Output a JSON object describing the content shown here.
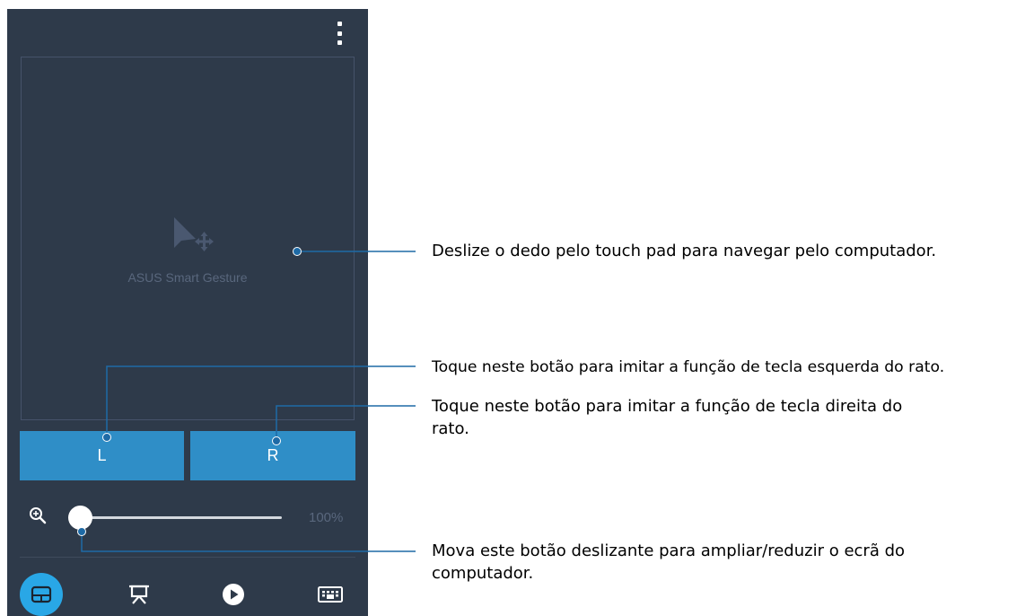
{
  "touchpad": {
    "label": "ASUS Smart Gesture"
  },
  "buttons": {
    "left_label": "L",
    "right_label": "R"
  },
  "zoom": {
    "value_text": "100%",
    "slider_level_percent": 0
  },
  "nav": {
    "items": [
      {
        "icon": "touchpad-icon",
        "active": true
      },
      {
        "icon": "presentation-icon",
        "active": false
      },
      {
        "icon": "play-icon",
        "active": false
      },
      {
        "icon": "keyboard-icon",
        "active": false
      }
    ]
  },
  "callouts": {
    "touchpad": "Deslize o dedo pelo touch pad para navegar pelo computador.",
    "left_button": "Toque neste botão para imitar a função de tecla esquerda do rato.",
    "right_button_line1": "Toque neste botão para imitar a função de tecla direita do",
    "right_button_line2": "rato.",
    "slider_line1": "Mova este botão deslizante para ampliar/reduzir o ecrã do",
    "slider_line2": "computador."
  },
  "colors": {
    "panel": "#2e3a4a",
    "button": "#2f8ec7",
    "active_nav": "#29a7e6",
    "callout_line": "#1e6aa6"
  }
}
